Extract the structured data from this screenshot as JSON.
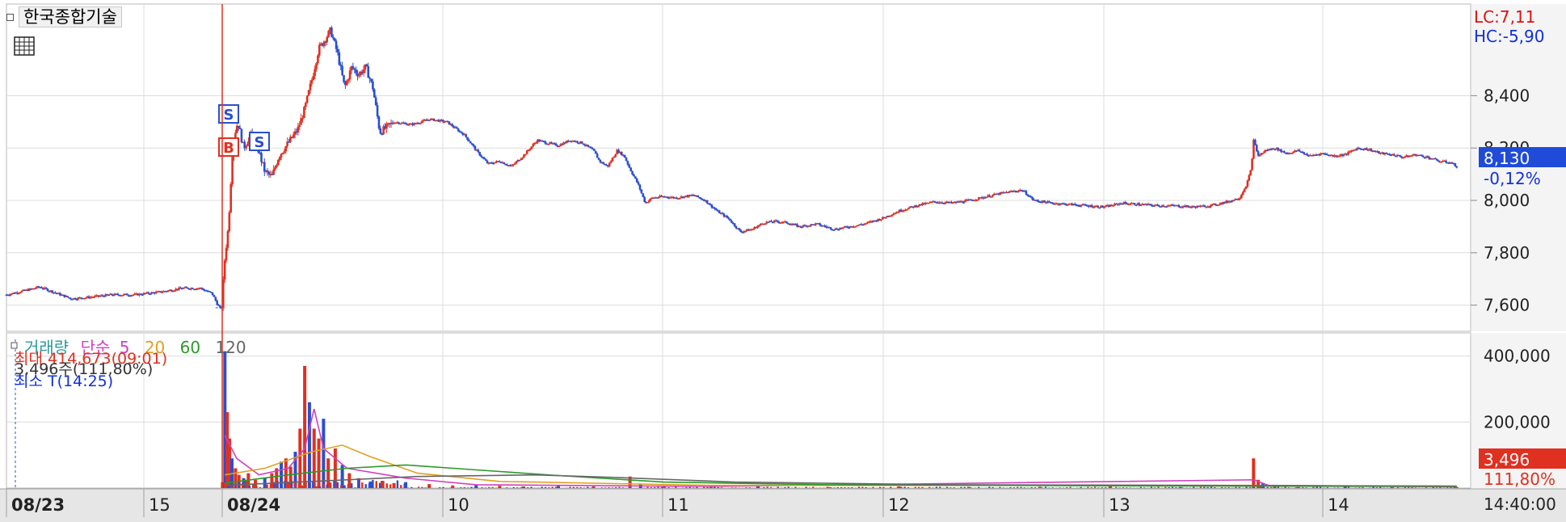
{
  "title": "한국종합기술",
  "icons": {
    "table": "table-grid-icon",
    "legend_marker": "square-marker-icon"
  },
  "colors": {
    "up": "#e03020",
    "down": "#2a4fd0",
    "grid": "#dcdcdc",
    "axis_bg": "#f2f2f2",
    "lc": "#e01010",
    "hc": "#1030e0"
  },
  "price_panel": {
    "lc_label": "LC:7,11",
    "hc_label": "HC:-5,90",
    "current_price": "8,130",
    "change_pct": "-0,12%",
    "trade_markers": [
      "S",
      "B",
      "S"
    ]
  },
  "volume_panel": {
    "legend": [
      {
        "label": "거래량",
        "color": "#2a9a9a"
      },
      {
        "label": "단순",
        "color": "#d040c0"
      },
      {
        "label": "5",
        "color": "#d040c0"
      },
      {
        "label": "20",
        "color": "#e0a020"
      },
      {
        "label": "60",
        "color": "#2a9a2a"
      },
      {
        "label": "120",
        "color": "#666666"
      }
    ],
    "max_text": "최대 414,673(09:01)",
    "vol_text": "3,496주(111,80%)",
    "min_text": "최소 T(14:25)",
    "current_volume": "3,496",
    "current_ratio": "111,80%"
  },
  "x_axis": {
    "labels": [
      "08/23",
      "15",
      "08/24",
      "10",
      "11",
      "12",
      "13",
      "14"
    ],
    "current_time": "14:40:00"
  },
  "chart_data": [
    {
      "type": "candlestick",
      "title": "한국종합기술",
      "ylim": [
        7500,
        8750
      ],
      "y_ticks": [
        7600,
        7800,
        8000,
        8200,
        8400
      ],
      "y_tick_labels": [
        "7,600",
        "7,800",
        "8,000",
        "8,200",
        "8,400"
      ],
      "annotations": [
        "LC:7,11",
        "HC:-5,90"
      ],
      "last_price": 8130,
      "last_change_pct": "-0,12%",
      "path": [
        [
          0,
          7640
        ],
        [
          10,
          7650
        ],
        [
          20,
          7660
        ],
        [
          28,
          7670
        ],
        [
          40,
          7650
        ],
        [
          55,
          7625
        ],
        [
          70,
          7630
        ],
        [
          90,
          7640
        ],
        [
          110,
          7640
        ],
        [
          130,
          7650
        ],
        [
          150,
          7665
        ],
        [
          165,
          7665
        ],
        [
          175,
          7645
        ],
        [
          180,
          7600
        ],
        [
          183,
          7580
        ],
        [
          186,
          7780
        ],
        [
          189,
          7900
        ],
        [
          193,
          8230
        ],
        [
          197,
          8300
        ],
        [
          202,
          8200
        ],
        [
          208,
          8250
        ],
        [
          214,
          8200
        ],
        [
          220,
          8110
        ],
        [
          226,
          8090
        ],
        [
          232,
          8170
        ],
        [
          240,
          8220
        ],
        [
          248,
          8270
        ],
        [
          254,
          8350
        ],
        [
          260,
          8460
        ],
        [
          266,
          8580
        ],
        [
          272,
          8620
        ],
        [
          276,
          8650
        ],
        [
          282,
          8560
        ],
        [
          288,
          8430
        ],
        [
          294,
          8510
        ],
        [
          300,
          8480
        ],
        [
          306,
          8510
        ],
        [
          312,
          8430
        ],
        [
          318,
          8260
        ],
        [
          330,
          8300
        ],
        [
          345,
          8290
        ],
        [
          360,
          8310
        ],
        [
          375,
          8300
        ],
        [
          390,
          8250
        ],
        [
          402,
          8180
        ],
        [
          410,
          8140
        ],
        [
          420,
          8150
        ],
        [
          430,
          8130
        ],
        [
          440,
          8170
        ],
        [
          452,
          8230
        ],
        [
          460,
          8220
        ],
        [
          470,
          8210
        ],
        [
          480,
          8230
        ],
        [
          490,
          8220
        ],
        [
          500,
          8190
        ],
        [
          505,
          8150
        ],
        [
          512,
          8130
        ],
        [
          520,
          8190
        ],
        [
          526,
          8170
        ],
        [
          531,
          8120
        ],
        [
          538,
          8060
        ],
        [
          544,
          7990
        ],
        [
          550,
          8010
        ],
        [
          560,
          8015
        ],
        [
          570,
          8010
        ],
        [
          585,
          8020
        ],
        [
          595,
          8000
        ],
        [
          605,
          7960
        ],
        [
          615,
          7930
        ],
        [
          625,
          7880
        ],
        [
          635,
          7890
        ],
        [
          645,
          7915
        ],
        [
          655,
          7920
        ],
        [
          665,
          7915
        ],
        [
          675,
          7900
        ],
        [
          690,
          7910
        ],
        [
          705,
          7890
        ],
        [
          718,
          7900
        ],
        [
          730,
          7910
        ],
        [
          745,
          7930
        ],
        [
          760,
          7960
        ],
        [
          775,
          7980
        ],
        [
          790,
          7995
        ],
        [
          805,
          7990
        ],
        [
          820,
          8000
        ],
        [
          835,
          8015
        ],
        [
          850,
          8030
        ],
        [
          865,
          8040
        ],
        [
          875,
          8000
        ],
        [
          890,
          7990
        ],
        [
          905,
          7985
        ],
        [
          920,
          7980
        ],
        [
          935,
          7975
        ],
        [
          950,
          7990
        ],
        [
          965,
          7985
        ],
        [
          980,
          7980
        ],
        [
          995,
          7980
        ],
        [
          1010,
          7975
        ],
        [
          1025,
          7980
        ],
        [
          1040,
          7995
        ],
        [
          1050,
          8010
        ],
        [
          1056,
          8060
        ],
        [
          1060,
          8120
        ],
        [
          1062,
          8230
        ],
        [
          1066,
          8170
        ],
        [
          1072,
          8190
        ],
        [
          1080,
          8200
        ],
        [
          1090,
          8180
        ],
        [
          1100,
          8190
        ],
        [
          1110,
          8170
        ],
        [
          1120,
          8180
        ],
        [
          1130,
          8170
        ],
        [
          1140,
          8175
        ],
        [
          1150,
          8200
        ],
        [
          1160,
          8195
        ],
        [
          1170,
          8180
        ],
        [
          1180,
          8175
        ],
        [
          1190,
          8165
        ],
        [
          1200,
          8175
        ],
        [
          1210,
          8165
        ],
        [
          1220,
          8150
        ],
        [
          1230,
          8145
        ],
        [
          1235,
          8130
        ]
      ]
    },
    {
      "type": "bar",
      "title": "거래량",
      "ylim": [
        0,
        470000
      ],
      "y_ticks": [
        200000,
        400000
      ],
      "y_tick_labels": [
        "200,000",
        "400,000"
      ],
      "max_volume": 414673,
      "current_volume": 3496,
      "volume_spikes": [
        [
          184,
          18000
        ],
        [
          186,
          414673
        ],
        [
          188,
          230000
        ],
        [
          190,
          150000
        ],
        [
          192,
          90000
        ],
        [
          195,
          60000
        ],
        [
          198,
          40000
        ],
        [
          202,
          30000
        ],
        [
          206,
          45000
        ],
        [
          212,
          25000
        ],
        [
          220,
          30000
        ],
        [
          226,
          45000
        ],
        [
          230,
          60000
        ],
        [
          234,
          80000
        ],
        [
          238,
          90000
        ],
        [
          242,
          65000
        ],
        [
          246,
          110000
        ],
        [
          250,
          180000
        ],
        [
          254,
          370000
        ],
        [
          258,
          260000
        ],
        [
          262,
          180000
        ],
        [
          266,
          150000
        ],
        [
          270,
          210000
        ],
        [
          274,
          90000
        ],
        [
          280,
          120000
        ],
        [
          286,
          70000
        ],
        [
          292,
          45000
        ],
        [
          300,
          30000
        ],
        [
          310,
          20000
        ],
        [
          320,
          22000
        ],
        [
          330,
          15000
        ],
        [
          340,
          18000
        ],
        [
          360,
          12000
        ],
        [
          380,
          8000
        ],
        [
          400,
          9000
        ],
        [
          420,
          7000
        ],
        [
          440,
          5000
        ],
        [
          470,
          6000
        ],
        [
          500,
          5000
        ],
        [
          531,
          35000
        ],
        [
          540,
          12000
        ],
        [
          560,
          4000
        ],
        [
          600,
          5000
        ],
        [
          640,
          8000
        ],
        [
          700,
          3000
        ],
        [
          760,
          5000
        ],
        [
          820,
          3000
        ],
        [
          880,
          4000
        ],
        [
          940,
          6000
        ],
        [
          1000,
          3000
        ],
        [
          1062,
          90000
        ],
        [
          1066,
          25000
        ],
        [
          1070,
          15000
        ],
        [
          1080,
          8000
        ],
        [
          1100,
          3000
        ],
        [
          1140,
          5000
        ],
        [
          1180,
          3000
        ],
        [
          1235,
          3496
        ]
      ],
      "moving_averages": [
        {
          "label": "5",
          "color": "#d040c0",
          "points": [
            [
              186,
              160000
            ],
            [
              196,
              90000
            ],
            [
              215,
              40000
            ],
            [
              240,
              60000
            ],
            [
              254,
              120000
            ],
            [
              262,
              240000
            ],
            [
              270,
              120000
            ],
            [
              290,
              60000
            ],
            [
              340,
              30000
            ],
            [
              400,
              10000
            ],
            [
              600,
              5000
            ],
            [
              1062,
              25000
            ],
            [
              1075,
              8000
            ],
            [
              1235,
              4000
            ]
          ]
        },
        {
          "label": "20",
          "color": "#e0a020",
          "points": [
            [
              186,
              40000
            ],
            [
              220,
              60000
            ],
            [
              260,
              110000
            ],
            [
              286,
              130000
            ],
            [
              310,
              95000
            ],
            [
              350,
              45000
            ],
            [
              420,
              20000
            ],
            [
              600,
              8000
            ],
            [
              1062,
              8000
            ],
            [
              1100,
              7000
            ],
            [
              1235,
              5000
            ]
          ]
        },
        {
          "label": "60",
          "color": "#2a9a2a",
          "points": [
            [
              186,
              15000
            ],
            [
              240,
              40000
            ],
            [
              290,
              60000
            ],
            [
              340,
              70000
            ],
            [
              400,
              55000
            ],
            [
              470,
              38000
            ],
            [
              560,
              18000
            ],
            [
              700,
              10000
            ],
            [
              1000,
              6000
            ],
            [
              1235,
              5000
            ]
          ]
        },
        {
          "label": "120",
          "color": "#666666",
          "points": [
            [
              186,
              8000
            ],
            [
              260,
              20000
            ],
            [
              350,
              35000
            ],
            [
              450,
              40000
            ],
            [
              520,
              32000
            ],
            [
              620,
              18000
            ],
            [
              800,
              10000
            ],
            [
              1235,
              6000
            ]
          ]
        }
      ]
    }
  ]
}
